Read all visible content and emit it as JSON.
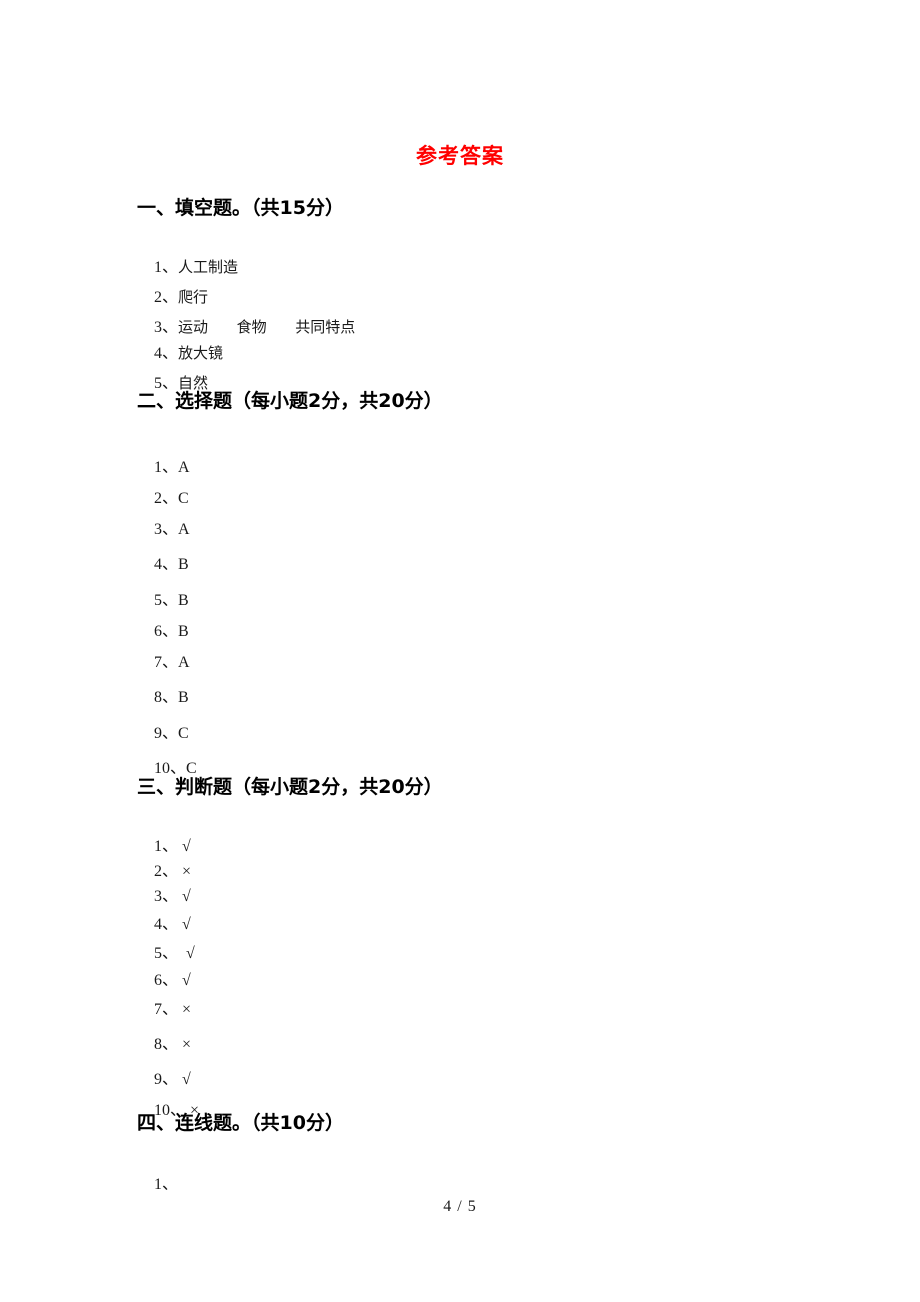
{
  "document": {
    "title": "参考答案",
    "title_color": "#ff0000"
  },
  "sections": [
    {
      "heading": "一、填空题。（共15分）",
      "items": [
        {
          "num": "1、",
          "value": "人工制造"
        },
        {
          "num": "2、",
          "value": "爬行"
        },
        {
          "num": "3、",
          "value": "运动      食物      共同特点"
        },
        {
          "num": "4、",
          "value": "放大镜"
        },
        {
          "num": "5、",
          "value": "自然"
        }
      ]
    },
    {
      "heading": "二、选择题（每小题2分，共20分）",
      "items": [
        {
          "num": "1、",
          "value": "A"
        },
        {
          "num": "2、",
          "value": "C"
        },
        {
          "num": "3、",
          "value": "A"
        },
        {
          "num": "4、",
          "value": "B"
        },
        {
          "num": "5、",
          "value": "B"
        },
        {
          "num": "6、",
          "value": "B"
        },
        {
          "num": "7、",
          "value": "A"
        },
        {
          "num": "8、",
          "value": "B"
        },
        {
          "num": "9、",
          "value": "C"
        },
        {
          "num": "10、",
          "value": "C"
        }
      ]
    },
    {
      "heading": "三、判断题（每小题2分，共20分）",
      "items": [
        {
          "num": "1、",
          "value": " √"
        },
        {
          "num": "2、",
          "value": " ×"
        },
        {
          "num": "3、",
          "value": " √"
        },
        {
          "num": "4、",
          "value": " √"
        },
        {
          "num": "5、",
          "value": "  √"
        },
        {
          "num": "6、",
          "value": " √"
        },
        {
          "num": "7、",
          "value": " ×"
        },
        {
          "num": "8、",
          "value": " ×"
        },
        {
          "num": "9、",
          "value": " √"
        },
        {
          "num": "10、",
          "value": " ×"
        }
      ]
    },
    {
      "heading": "四、连线题。（共10分）",
      "items": [
        {
          "num": "1、",
          "value": ""
        }
      ]
    }
  ],
  "footer": {
    "page_number": "4 / 5"
  }
}
